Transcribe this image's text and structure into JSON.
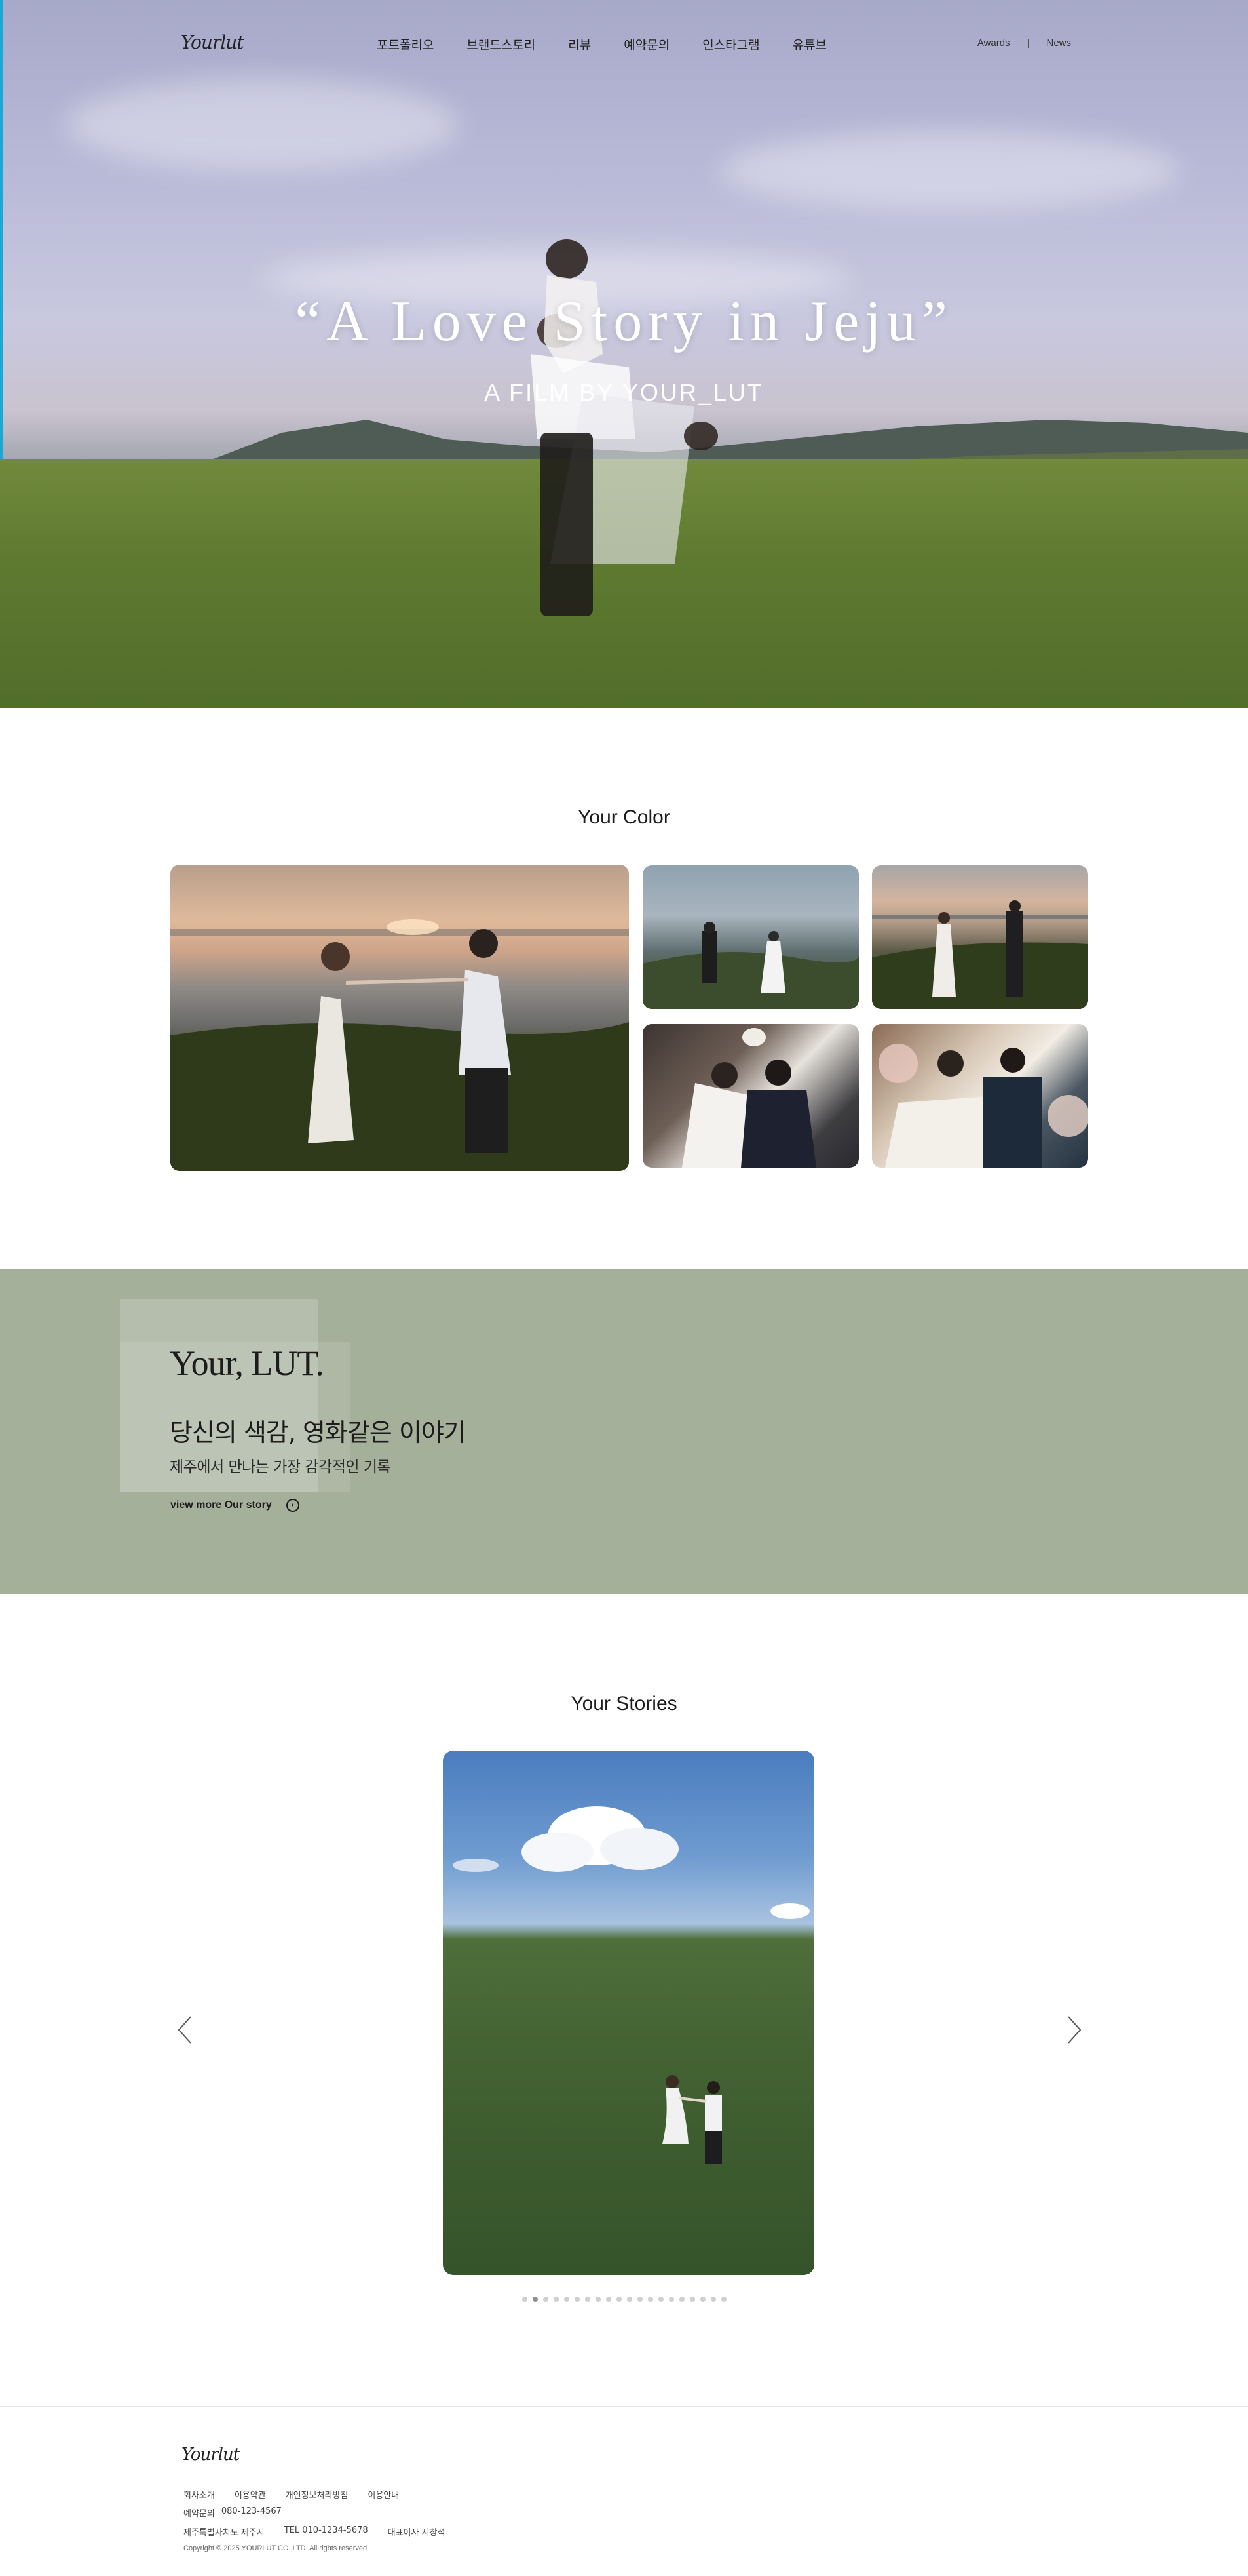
{
  "header": {
    "logo_text": "Yourlut",
    "menu": [
      {
        "label": "포트폴리오"
      },
      {
        "label": "브랜드스토리"
      },
      {
        "label": "리뷰"
      },
      {
        "label": "예약문의"
      },
      {
        "label": "인스타그램"
      },
      {
        "label": "유튜브"
      }
    ],
    "util_links": [
      "Awards",
      "News"
    ],
    "util_separator": "|"
  },
  "hero": {
    "title": "“A Love Story in Jeju”",
    "subtitle": "A FILM BY YOUR_LUT"
  },
  "your_color": {
    "title": "Your Color"
  },
  "your_lut": {
    "heading": "Your, LUT.",
    "headline": "당신의 색감, 영화같은 이야기",
    "subline": "제주에서 만나는 가장 감각적인 기록",
    "more_label": "view more Our story",
    "background_color": "#a5b09b"
  },
  "your_stories": {
    "title": "Your Stories",
    "prev_icon": "chevron-left-icon",
    "next_icon": "chevron-right-icon",
    "slide_count": 20,
    "active_slide": 2
  },
  "footer": {
    "logo_text": "Yourlut",
    "links": [
      "회사소개",
      "이용약관",
      "개인정보처리방침",
      "이용안내"
    ],
    "contact_label": "예약문의",
    "contact_phone": "080-123-4567",
    "address": "제주특별자치도 제주시",
    "tel": "TEL 010-1234-5678",
    "ceo": "대표이사 서창석",
    "copyright": "Copyright © 2025 YOURLUT CO.,LTD. All rights reserved."
  }
}
